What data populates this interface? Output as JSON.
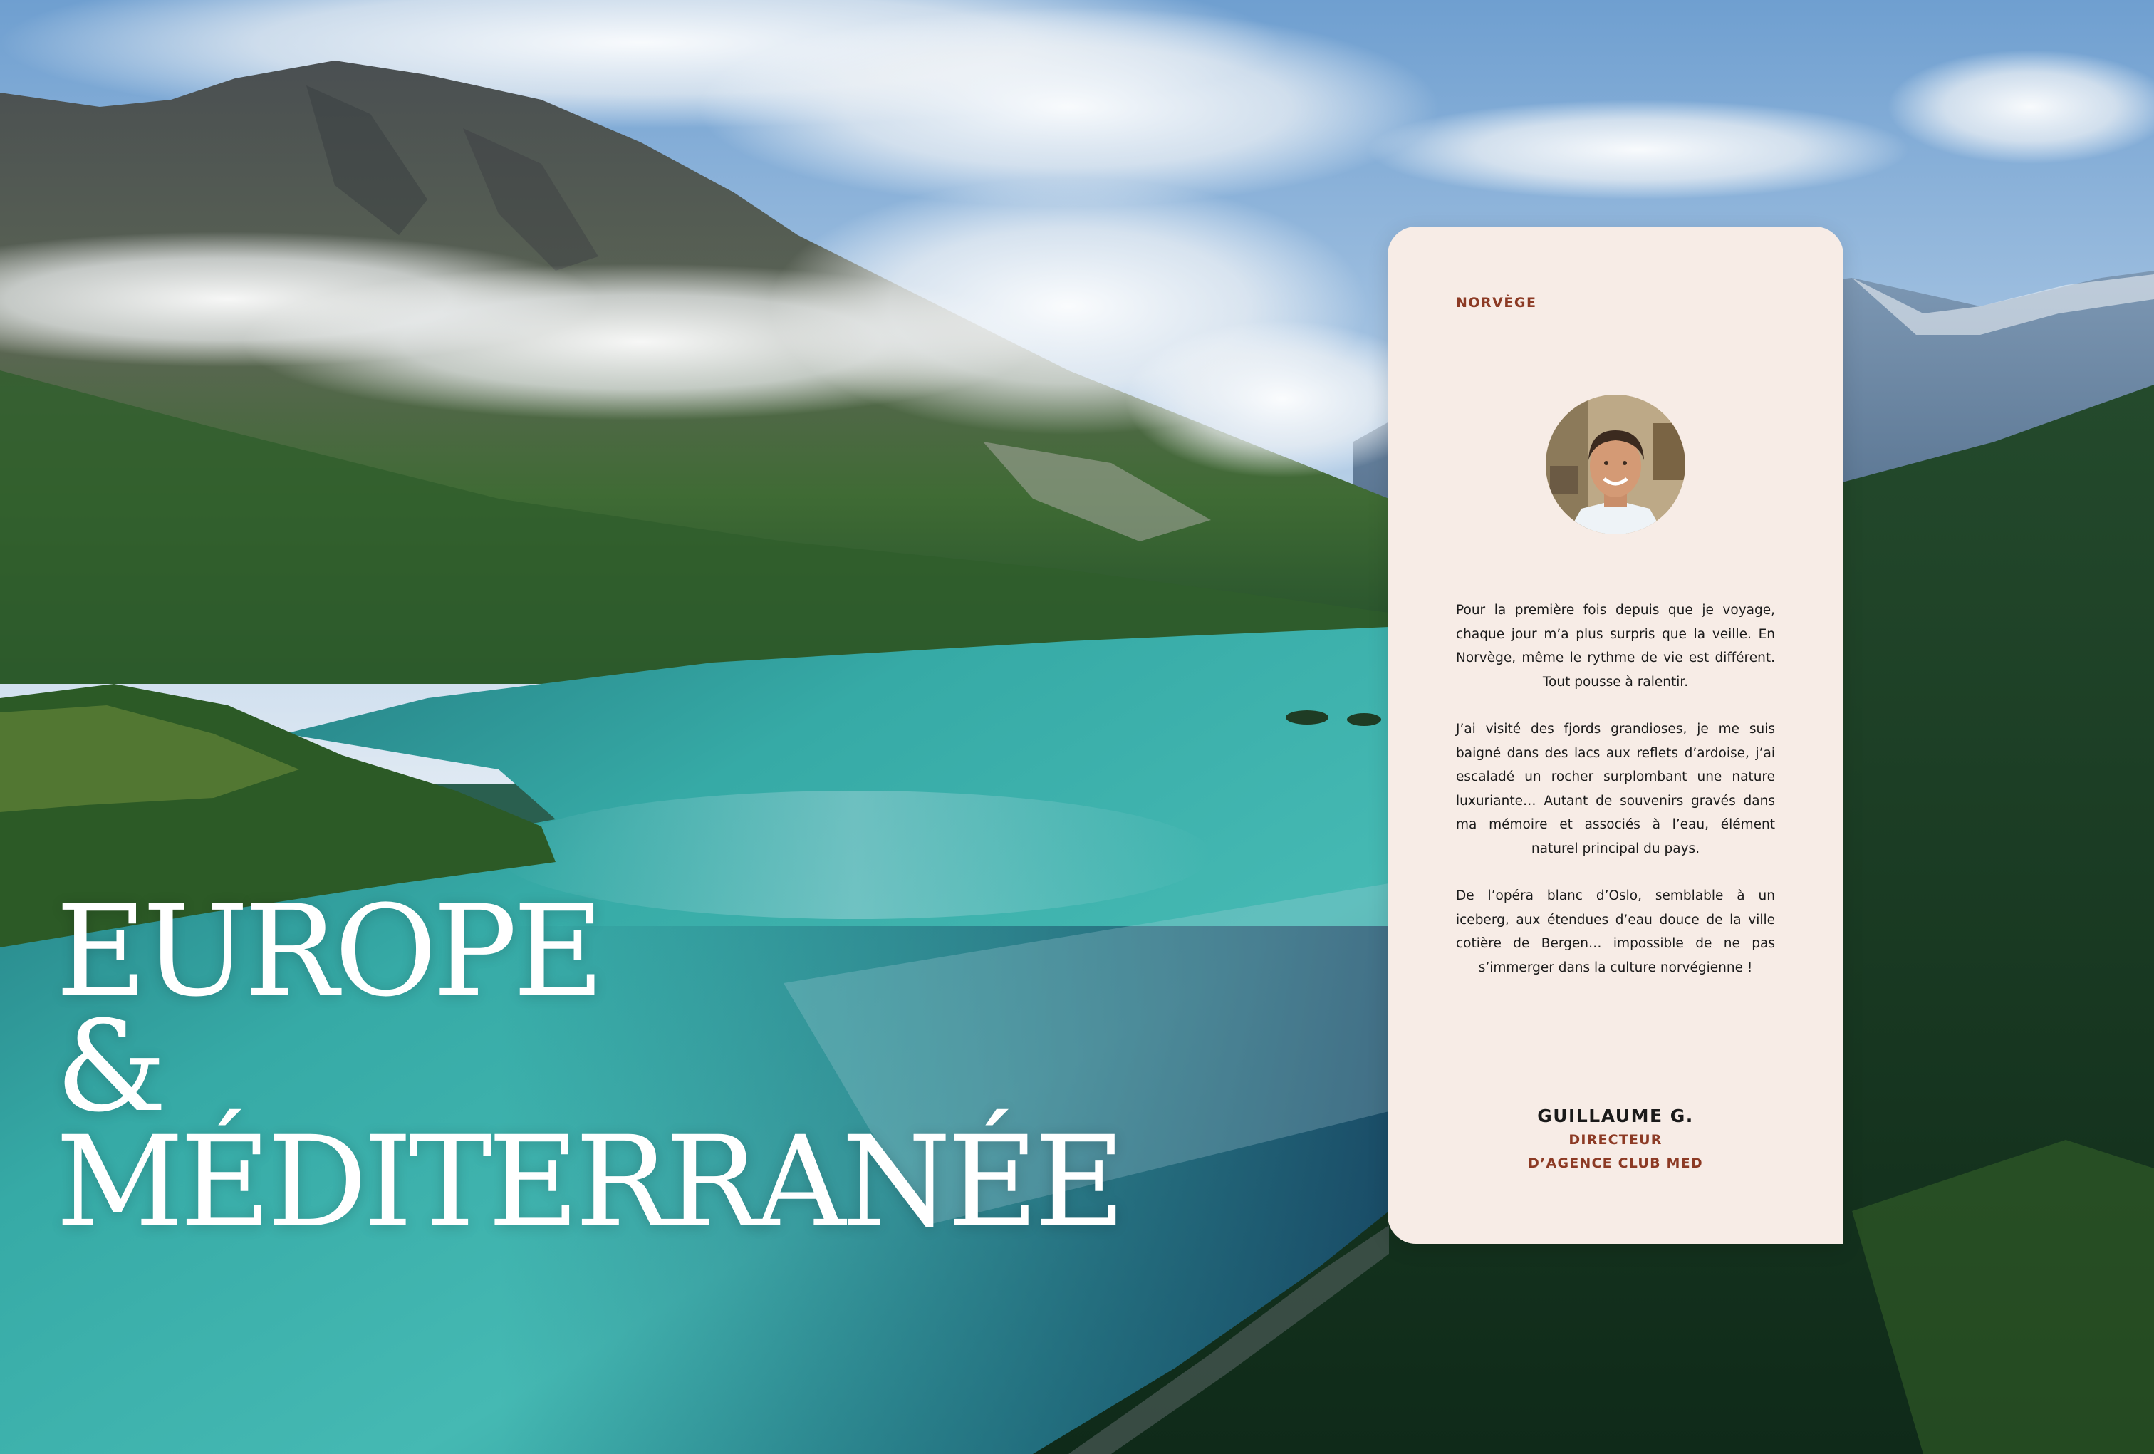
{
  "hero": {
    "line1": "EUROPE",
    "line2": "&",
    "line3": "MÉDITERRANÉE"
  },
  "card": {
    "country": "NORVÈGE",
    "paragraphs": [
      "Pour la première fois depuis que je voyage, chaque jour m’a plus surpris que la veille. En Norvège, même le rythme de vie est différent. Tout pousse à ralentir.",
      "J’ai visité des fjords grandioses, je me suis baigné dans des lacs aux reflets d’ardoise, j’ai escaladé un rocher surplombant une nature luxuriante… Autant de souvenirs gravés dans ma mémoire et associés à l’eau, élément naturel principal du pays.",
      "De l’opéra blanc d’Oslo, semblable à un iceberg, aux étendues d’eau douce de la ville cotière de Bergen… impossible de ne pas s’immerger dans la culture norvégienne !"
    ],
    "author_name": "GUILLAUME G.",
    "author_role_line1": "DIRECTEUR",
    "author_role_line2": "D’AGENCE CLUB MED"
  },
  "colors": {
    "card_background": "#f7ece6",
    "accent_rust": "#8c3a24",
    "title_white": "#ffffff",
    "fjord_turquoise": "#3fb3b0"
  }
}
